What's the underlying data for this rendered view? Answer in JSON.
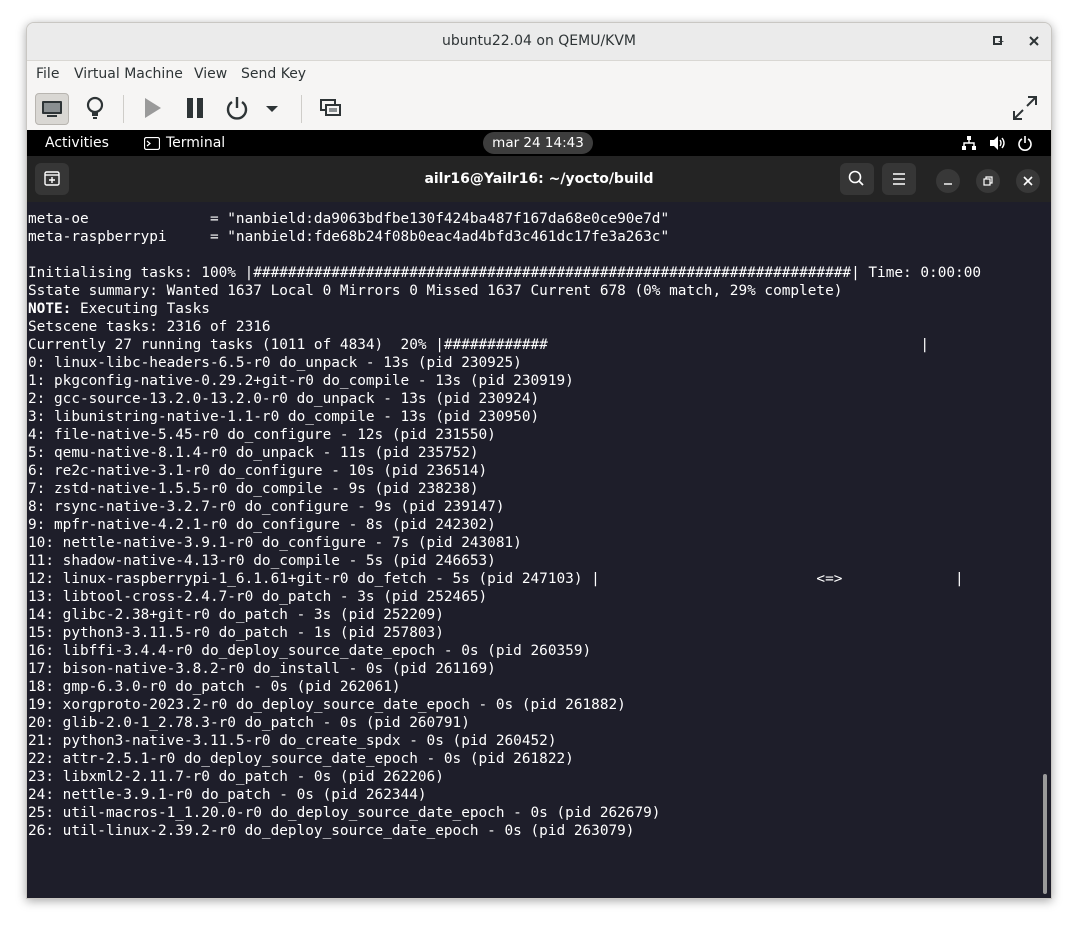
{
  "window": {
    "title": "ubuntu22.04 on QEMU/KVM",
    "controls": {
      "minimize": "–",
      "maximize": "□",
      "close": "✕"
    }
  },
  "menu": [
    "File",
    "Virtual Machine",
    "View",
    "Send Key"
  ],
  "toolbar": {
    "icons": [
      "monitor-icon",
      "lightbulb-icon",
      "play-icon",
      "pause-icon",
      "power-icon",
      "dropdown-arrow-icon",
      "screenshot-icon",
      "fullscreen-icon"
    ]
  },
  "gnome": {
    "activities": "Activities",
    "app": "Terminal",
    "clock": "mar 24  14:43"
  },
  "terminal": {
    "title": "ailr16@Yailr16: ~/yocto/build",
    "lines": [
      "meta-oe              = \"nanbield:da9063bdfbe130f424ba487f167da68e0ce90e7d\"",
      "meta-raspberrypi     = \"nanbield:fde68b24f08b0eac4ad4bfd3c461dc17fe3a263c\"",
      "",
      "Initialising tasks: 100% |#####################################################################| Time: 0:00:00",
      "Sstate summary: Wanted 1637 Local 0 Mirrors 0 Missed 1637 Current 678 (0% match, 29% complete)",
      "NOTE: Executing Tasks",
      "Setscene tasks: 2316 of 2316",
      "Currently 27 running tasks (1011 of 4834)  20% |############                                           |",
      "0: linux-libc-headers-6.5-r0 do_unpack - 13s (pid 230925)",
      "1: pkgconfig-native-0.29.2+git-r0 do_compile - 13s (pid 230919)",
      "2: gcc-source-13.2.0-13.2.0-r0 do_unpack - 13s (pid 230924)",
      "3: libunistring-native-1.1-r0 do_compile - 13s (pid 230950)",
      "4: file-native-5.45-r0 do_configure - 12s (pid 231550)",
      "5: qemu-native-8.1.4-r0 do_unpack - 11s (pid 235752)",
      "6: re2c-native-3.1-r0 do_configure - 10s (pid 236514)",
      "7: zstd-native-1.5.5-r0 do_compile - 9s (pid 238238)",
      "8: rsync-native-3.2.7-r0 do_configure - 9s (pid 239147)",
      "9: mpfr-native-4.2.1-r0 do_configure - 8s (pid 242302)",
      "10: nettle-native-3.9.1-r0 do_configure - 7s (pid 243081)",
      "11: shadow-native-4.13-r0 do_compile - 5s (pid 246653)",
      "12: linux-raspberrypi-1_6.1.61+git-r0 do_fetch - 5s (pid 247103) |                         <=>             |",
      "13: libtool-cross-2.4.7-r0 do_patch - 3s (pid 252465)",
      "14: glibc-2.38+git-r0 do_patch - 3s (pid 252209)",
      "15: python3-3.11.5-r0 do_patch - 1s (pid 257803)",
      "16: libffi-3.4.4-r0 do_deploy_source_date_epoch - 0s (pid 260359)",
      "17: bison-native-3.8.2-r0 do_install - 0s (pid 261169)",
      "18: gmp-6.3.0-r0 do_patch - 0s (pid 262061)",
      "19: xorgproto-2023.2-r0 do_deploy_source_date_epoch - 0s (pid 261882)",
      "20: glib-2.0-1_2.78.3-r0 do_patch - 0s (pid 260791)",
      "21: python3-native-3.11.5-r0 do_create_spdx - 0s (pid 260452)",
      "22: attr-2.5.1-r0 do_deploy_source_date_epoch - 0s (pid 261822)",
      "23: libxml2-2.11.7-r0 do_patch - 0s (pid 262206)",
      "24: nettle-3.9.1-r0 do_patch - 0s (pid 262344)",
      "25: util-macros-1_1.20.0-r0 do_deploy_source_date_epoch - 0s (pid 262679)",
      "26: util-linux-2.39.2-r0 do_deploy_source_date_epoch - 0s (pid 263079)"
    ]
  }
}
